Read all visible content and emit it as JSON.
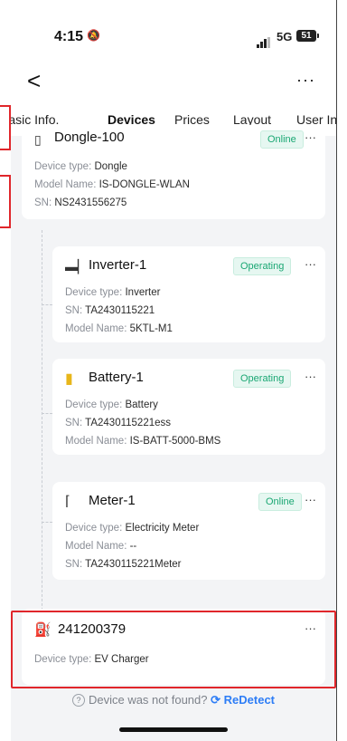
{
  "status": {
    "time": "4:15",
    "network": "5G",
    "battery": "51"
  },
  "nav": {
    "back": "<",
    "more": "···"
  },
  "tabs": [
    {
      "label": "Basic Info."
    },
    {
      "label": "Devices"
    },
    {
      "label": "Prices"
    },
    {
      "label": "Layout"
    },
    {
      "label": "User Info"
    }
  ],
  "dongle": {
    "title": "Dongle-100",
    "status": "Online",
    "type_label": "Device type:",
    "type_value": "Dongle",
    "model_label": "Model Name:",
    "model_value": "IS-DONGLE-WLAN",
    "sn_label": "SN:",
    "sn_value": "NS2431556275"
  },
  "inverter": {
    "title": "Inverter-1",
    "status": "Operating",
    "type_label": "Device type:",
    "type_value": "Inverter",
    "sn_label": "SN:",
    "sn_value": "TA2430115221",
    "model_label": "Model Name:",
    "model_value": "5KTL-M1"
  },
  "battery": {
    "title": "Battery-1",
    "status": "Operating",
    "type_label": "Device type:",
    "type_value": "Battery",
    "sn_label": "SN:",
    "sn_value": "TA2430115221ess",
    "model_label": "Model Name:",
    "model_value": "IS-BATT-5000-BMS"
  },
  "meter": {
    "title": "Meter-1",
    "status": "Online",
    "type_label": "Device type:",
    "type_value": "Electricity Meter",
    "model_label": "Model Name:",
    "model_value": "--",
    "sn_label": "SN:",
    "sn_value": "TA2430115221Meter"
  },
  "ev": {
    "title": "241200379",
    "type_label": "Device type:",
    "type_value": "EV Charger"
  },
  "card_more": "···",
  "footer": {
    "question": "Device was not found?",
    "link": "ReDetect"
  },
  "colors": {
    "accent": "#2d7df6",
    "status_green": "#1aa773",
    "highlight_red": "#e0262b"
  }
}
